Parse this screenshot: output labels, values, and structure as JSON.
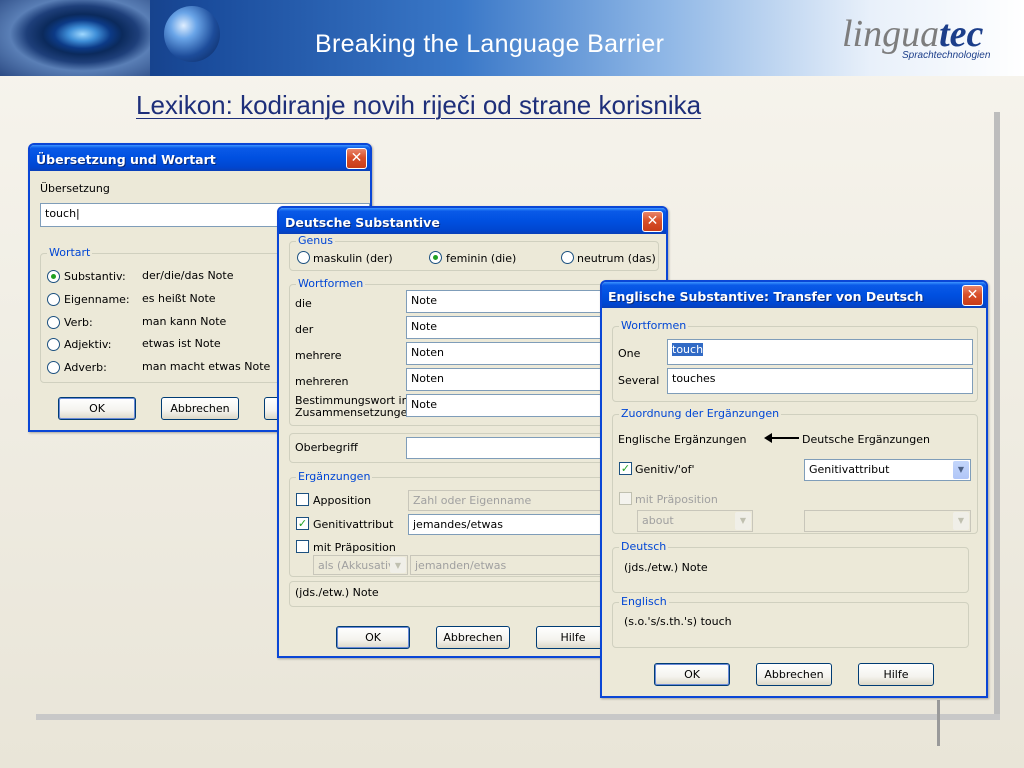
{
  "banner": {
    "tagline": "Breaking the Language Barrier",
    "logo_main": "lingua",
    "logo_accent": "tec",
    "logo_sub": "Sprachtechnologien"
  },
  "slide_title": "Lexikon: kodiranje novih riječi od strane korisnika",
  "win1": {
    "title": "Übersetzung und Wortart",
    "label_translation": "Übersetzung",
    "translation_value": "touch",
    "group_wordtype": "Wortart",
    "options": [
      {
        "label": "Substantiv:",
        "example": "der/die/das Note"
      },
      {
        "label": "Eigenname:",
        "example": "es heißt Note"
      },
      {
        "label": "Verb:",
        "example": "man kann Note"
      },
      {
        "label": "Adjektiv:",
        "example": "etwas ist Note"
      },
      {
        "label": "Adverb:",
        "example": "man macht etwas Note"
      }
    ],
    "ok": "OK",
    "cancel": "Abbrechen"
  },
  "win2": {
    "title": "Deutsche Substantive",
    "group_genus": "Genus",
    "genus": [
      "maskulin (der)",
      "feminin (die)",
      "neutrum (das)"
    ],
    "group_forms": "Wortformen",
    "forms": [
      {
        "label": "die",
        "value": "Note"
      },
      {
        "label": "der",
        "value": "Note"
      },
      {
        "label": "mehrere",
        "value": "Noten"
      },
      {
        "label": "mehreren",
        "value": "Noten"
      }
    ],
    "compound_label_1": "Bestimmungswort in",
    "compound_label_2": "Zusammensetzungen",
    "compound_value": "Note",
    "hypernym_label": "Oberbegriff",
    "group_complements": "Ergänzungen",
    "apposition": "Apposition",
    "apposition_value": "Zahl oder Eigenname",
    "genitive": "Genitivattribut",
    "genitive_value": "jemandes/etwas",
    "preposition": "mit Präposition",
    "preposition_combo": "als (Akkusativ",
    "preposition_value": "jemanden/etwas",
    "summary": "(jds./etw.) Note",
    "ok": "OK",
    "cancel": "Abbrechen",
    "help": "Hilfe"
  },
  "win3": {
    "title": "Englische Substantive: Transfer von Deutsch",
    "group_forms": "Wortformen",
    "one_label": "One",
    "one_value": "touch",
    "several_label": "Several",
    "several_value": "touches",
    "group_assign": "Zuordnung der Ergänzungen",
    "english_compl": "Englische Ergänzungen",
    "german_compl": "Deutsche Ergänzungen",
    "genitive_of": "Genitiv/'of'",
    "genitive_combo": "Genitivattribut",
    "preposition": "mit Präposition",
    "preposition_combo": "about",
    "group_german": "Deutsch",
    "german_text": "(jds./etw.) Note",
    "group_english": "Englisch",
    "english_text": "(s.o.'s/s.th.'s) touch",
    "ok": "OK",
    "cancel": "Abbrechen",
    "help": "Hilfe"
  }
}
